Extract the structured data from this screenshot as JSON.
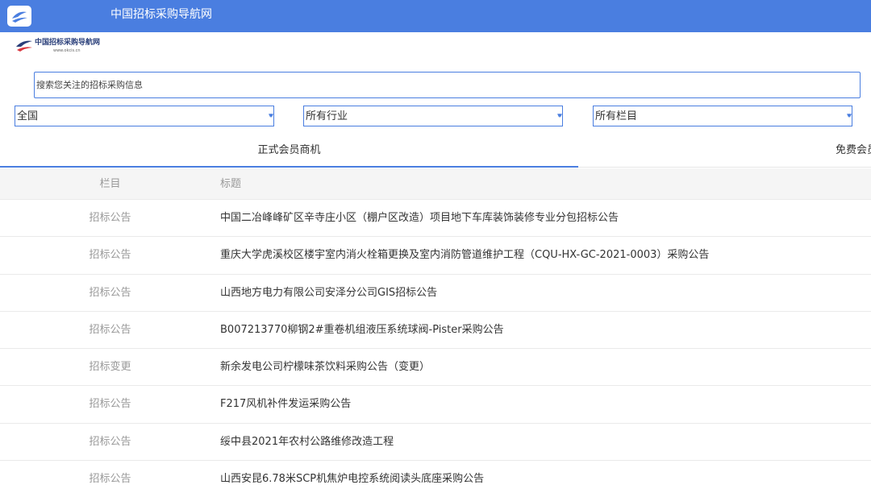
{
  "header": {
    "title": "中国招标采购导航网"
  },
  "logo": {
    "text": "中国招标采购导航网",
    "url": "www.okcis.cn"
  },
  "search": {
    "placeholder": "搜索您关注的招标采购信息",
    "value": ""
  },
  "filters": {
    "region": "全国",
    "industry": "所有行业",
    "column": "所有栏目",
    "arrow": "▾▾"
  },
  "tabs": [
    {
      "label": "正式会员商机",
      "active": true
    },
    {
      "label": "免费会员"
    }
  ],
  "table": {
    "headers": [
      "栏目",
      "标题"
    ],
    "rows": [
      {
        "category": "招标公告",
        "title": "中国二冶峰峰矿区辛寺庄小区（棚户区改造）项目地下车库装饰装修专业分包招标公告"
      },
      {
        "category": "招标公告",
        "title": "重庆大学虎溪校区楼宇室内消火栓箱更换及室内消防管道维护工程（CQU-HX-GC-2021-0003）采购公告"
      },
      {
        "category": "招标公告",
        "title": "山西地方电力有限公司安泽分公司GIS招标公告"
      },
      {
        "category": "招标公告",
        "title": "B007213770柳钢2#重卷机组液压系统球阀-Pister采购公告"
      },
      {
        "category": "招标变更",
        "title": "新余发电公司柠檬味茶饮料采购公告（变更）"
      },
      {
        "category": "招标公告",
        "title": "F217风机补件发运采购公告"
      },
      {
        "category": "招标公告",
        "title": "绥中县2021年农村公路维修改造工程"
      },
      {
        "category": "招标公告",
        "title": "山西安昆6.78米SCP机焦炉电控系统阅读头底座采购公告"
      }
    ]
  },
  "colors": {
    "accent": "#4a7ee0",
    "muted_text": "#999999"
  }
}
